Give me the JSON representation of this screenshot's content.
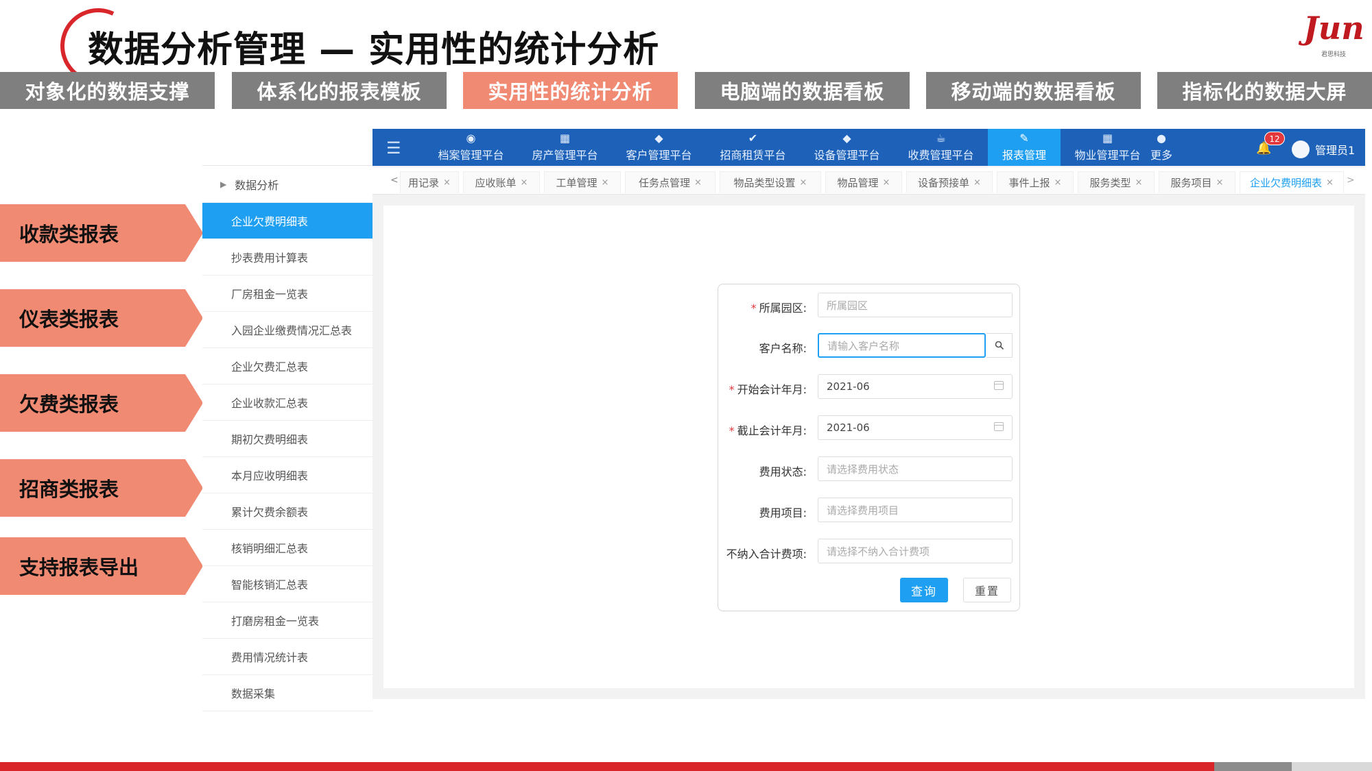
{
  "slide": {
    "title": "数据分析管理 — 实用性的统计分析",
    "logo_text": "Jun",
    "logo_sub": "君思科技"
  },
  "top_tabs": [
    {
      "label": "对象化的数据支撑"
    },
    {
      "label": "体系化的报表模板"
    },
    {
      "label": "实用性的统计分析"
    },
    {
      "label": "电脑端的数据看板"
    },
    {
      "label": "移动端的数据看板"
    },
    {
      "label": "指标化的数据大屏"
    }
  ],
  "left_labels": [
    "收款类报表",
    "仪表类报表",
    "欠费类报表",
    "招商类报表",
    "支持报表导出"
  ],
  "sidebar": {
    "group": "数据分析",
    "items": [
      "企业欠费明细表",
      "抄表费用计算表",
      "厂房租金一览表",
      "入园企业缴费情况汇总表",
      "企业欠费汇总表",
      "企业收款汇总表",
      "期初欠费明细表",
      "本月应收明细表",
      "累计欠费余额表",
      "核销明细汇总表",
      "智能核销汇总表",
      "打磨房租金一览表",
      "费用情况统计表",
      "数据采集"
    ]
  },
  "navbar": {
    "items": [
      "档案管理平台",
      "房产管理平台",
      "客户管理平台",
      "招商租赁平台",
      "设备管理平台",
      "收费管理平台",
      "报表管理",
      "物业管理平台",
      "更多"
    ],
    "badge": "12",
    "user": "管理员1"
  },
  "tabbar": {
    "tabs": [
      "用记录",
      "应收账单",
      "工单管理",
      "任务点管理",
      "物品类型设置",
      "物品管理",
      "设备预接单",
      "事件上报",
      "服务类型",
      "服务项目",
      "企业欠费明细表"
    ]
  },
  "form": {
    "park_label": "所属园区:",
    "park_placeholder": "所属园区",
    "customer_label": "客户名称:",
    "customer_placeholder": "请输入客户名称",
    "start_label": "开始会计年月:",
    "start_value": "2021-06",
    "end_label": "截止会计年月:",
    "end_value": "2021-06",
    "status_label": "费用状态:",
    "status_placeholder": "请选择费用状态",
    "item_label": "费用项目:",
    "item_placeholder": "请选择费用项目",
    "exclude_label": "不纳入合计费项:",
    "exclude_placeholder": "请选择不纳入合计费项",
    "query_button": "查询",
    "reset_button": "重置"
  },
  "colors": {
    "accent_orange": "#f08a73",
    "nav_blue": "#1d62b8",
    "active_blue": "#1e9ff2",
    "brand_red": "#d9262b"
  }
}
